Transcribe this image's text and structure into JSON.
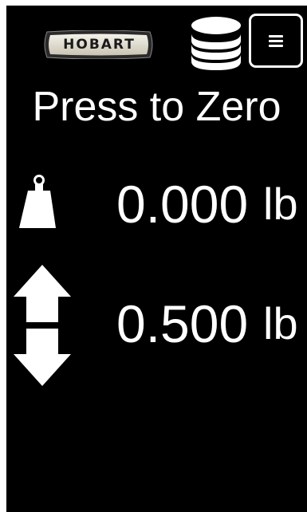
{
  "header": {
    "logo_text": "HOBART",
    "coins_icon": "coin-stack-icon",
    "menu_icon": "hamburger-menu-icon"
  },
  "title": "Press to Zero",
  "weight": {
    "icon": "weight-icon",
    "value": "0.000",
    "unit": "lb"
  },
  "tare": {
    "icon": "up-down-arrows-icon",
    "value": "0.500",
    "unit": "lb"
  },
  "colors": {
    "background": "#000000",
    "foreground": "#ffffff"
  }
}
